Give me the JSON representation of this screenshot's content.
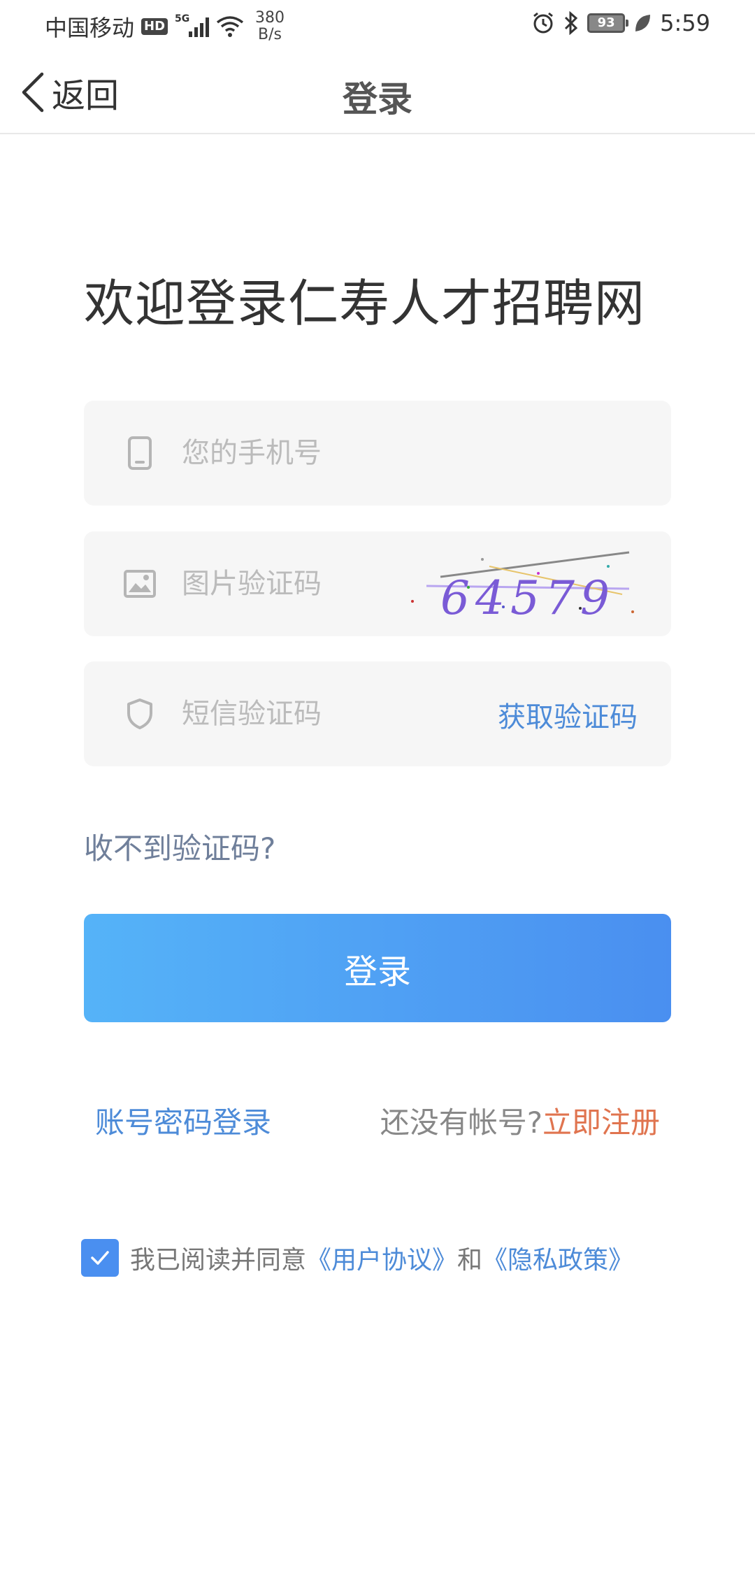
{
  "status_bar": {
    "carrier": "中国移动",
    "hd": "HD",
    "network": "5G",
    "net_speed_value": "380",
    "net_speed_unit": "B/s",
    "battery": "93",
    "time": "5:59"
  },
  "nav": {
    "back_label": "返回",
    "title": "登录"
  },
  "welcome_text": "欢迎登录仁寿人才招聘网",
  "form": {
    "phone_placeholder": "您的手机号",
    "captcha_placeholder": "图片验证码",
    "captcha_text": "64579",
    "sms_placeholder": "短信验证码",
    "get_code_label": "获取验证码",
    "no_code_label": "收不到验证码?",
    "login_label": "登录"
  },
  "alt_login": {
    "password_login_label": "账号密码登录",
    "no_account_text": "还没有帐号?",
    "register_label": "立即注册"
  },
  "agreement": {
    "checked": true,
    "prefix": "我已阅读并同意",
    "user_agreement": "《用户协议》",
    "and": "和",
    "privacy_policy": "《隐私政策》"
  },
  "colors": {
    "accent_blue": "#4d8bd8",
    "button_gradient_start": "#55b3f8",
    "button_gradient_end": "#4a8ff0",
    "register_orange": "#e0744f",
    "field_background": "#f6f6f6"
  },
  "icons": [
    "phone-icon",
    "image-icon",
    "shield-icon",
    "back-chevron-icon",
    "check-icon",
    "alarm-icon",
    "bluetooth-icon",
    "wifi-icon",
    "leaf-icon"
  ]
}
